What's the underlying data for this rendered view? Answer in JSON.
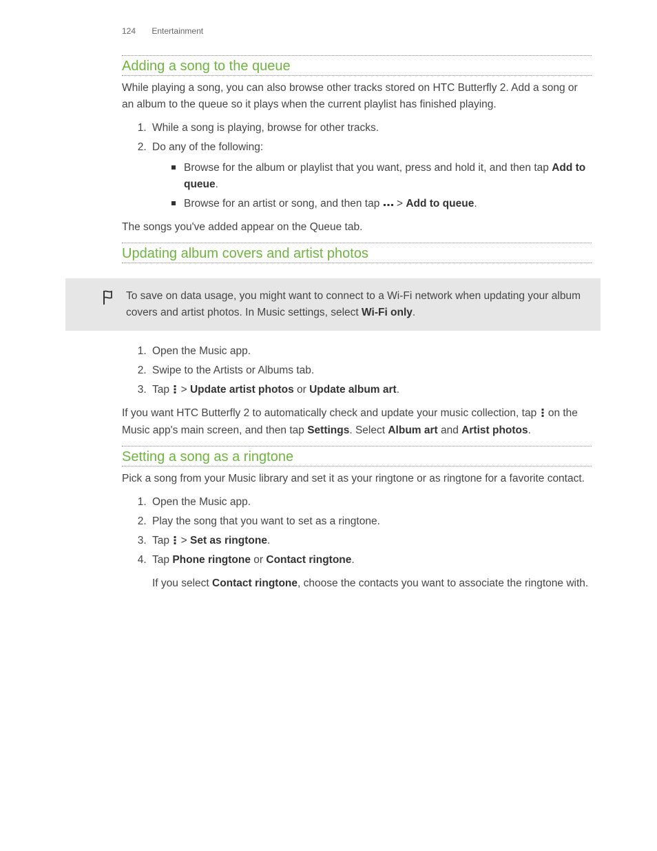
{
  "header": {
    "page_number": "124",
    "chapter": "Entertainment"
  },
  "s1": {
    "title": "Adding a song to the queue",
    "intro": "While playing a song, you can also browse other tracks stored on HTC Butterfly 2. Add a song or an album to the queue so it plays when the current playlist has finished playing.",
    "step1": "While a song is playing, browse for other tracks.",
    "step2": "Do any of the following:",
    "b1_a": "Browse for the album or playlist that you want, press and hold it, and then tap ",
    "b1_b": "Add to queue",
    "b1_c": ".",
    "b2_a": "Browse for an artist or song, and then tap ",
    "b2_b": " > ",
    "b2_c": "Add to queue",
    "b2_d": ".",
    "outro": "The songs you've added appear on the Queue tab."
  },
  "s2": {
    "title": "Updating album covers and artist photos",
    "callout_a": "To save on data usage, you might want to connect to a Wi-Fi network when updating your album covers and artist photos. In Music settings, select ",
    "callout_b": "Wi-Fi only",
    "callout_c": ".",
    "step1": "Open the Music app.",
    "step2": "Swipe to the Artists or Albums tab.",
    "step3_a": "Tap ",
    "step3_b": " > ",
    "step3_c": "Update artist photos",
    "step3_d": " or ",
    "step3_e": "Update album art",
    "step3_f": ".",
    "outro_a": "If you want HTC Butterfly 2 to automatically check and update your music collection, tap ",
    "outro_b": " on the Music app's main screen, and then tap ",
    "outro_c": "Settings",
    "outro_d": ". Select ",
    "outro_e": "Album art",
    "outro_f": " and ",
    "outro_g": "Artist photos",
    "outro_h": "."
  },
  "s3": {
    "title": "Setting a song as a ringtone",
    "intro": "Pick a song from your Music library and set it as your ringtone or as ringtone for a favorite contact.",
    "step1": "Open the Music app.",
    "step2": "Play the song that you want to set as a ringtone.",
    "step3_a": "Tap ",
    "step3_b": " > ",
    "step3_c": "Set as ringtone",
    "step3_d": ".",
    "step4_a": "Tap ",
    "step4_b": "Phone ringtone",
    "step4_c": " or ",
    "step4_d": "Contact ringtone",
    "step4_e": ".",
    "step4_note_a": "If you select ",
    "step4_note_b": "Contact ringtone",
    "step4_note_c": ", choose the contacts you want to associate the ringtone with."
  }
}
